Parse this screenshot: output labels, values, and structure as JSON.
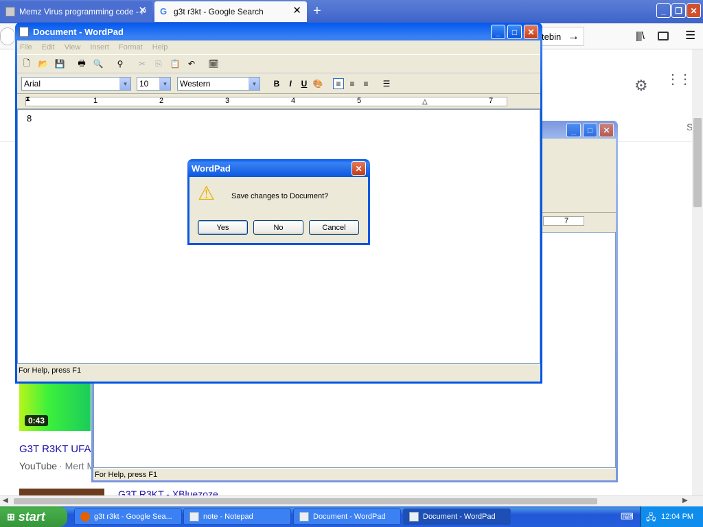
{
  "browser": {
    "tabs": [
      {
        "title": "Memz Virus programming code - P"
      },
      {
        "title": "g3t r3kt - Google Search"
      }
    ],
    "url_fragment": "tebin",
    "video": {
      "duration": "0:43",
      "title": "G3T R3KT UFA",
      "source": "YouTube",
      "channel": "Mert M"
    },
    "partial_result": "G3T R3KT - XBluezoze",
    "side_letter": "S"
  },
  "wordpad_main": {
    "title": "Document - WordPad",
    "menu": [
      "File",
      "Edit",
      "View",
      "Insert",
      "Format",
      "Help"
    ],
    "font": "Arial",
    "size": "10",
    "script": "Western",
    "ruler_marks": [
      "1",
      "2",
      "3",
      "4",
      "5",
      "7"
    ],
    "doc_text": "8",
    "status": "For Help, press F1"
  },
  "wordpad_back": {
    "ruler_mark": "7",
    "status": "For Help, press F1"
  },
  "dialog": {
    "title": "WordPad",
    "message": "Save changes to Document?",
    "buttons": {
      "yes": "Yes",
      "no": "No",
      "cancel": "Cancel"
    }
  },
  "taskbar": {
    "start_label": "start",
    "tasks": [
      {
        "label": "g3t r3kt - Google Sea..."
      },
      {
        "label": "note - Notepad"
      },
      {
        "label": "Document - WordPad"
      },
      {
        "label": "Document - WordPad"
      }
    ],
    "clock": "12:04 PM"
  },
  "colors": {
    "xp_blue": "#0054e3",
    "start_green": "#37953a",
    "face": "#ece9d8"
  }
}
